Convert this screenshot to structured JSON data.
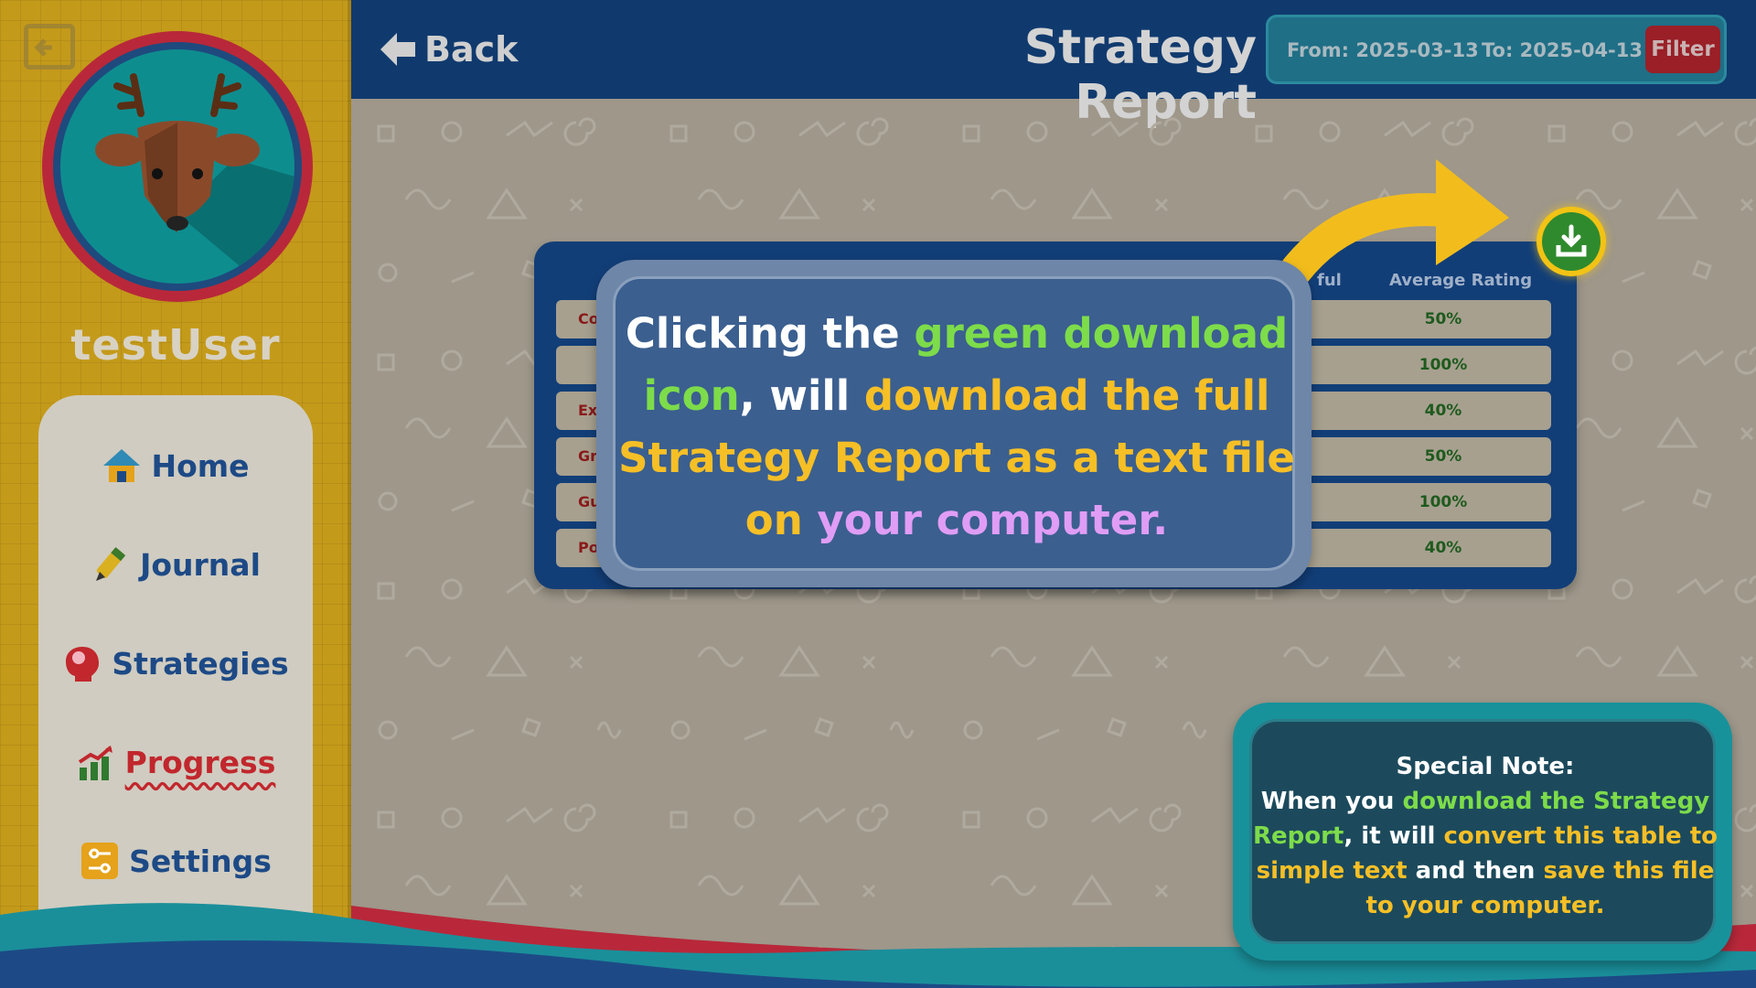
{
  "sidebar": {
    "username": "testUser",
    "nav": [
      {
        "label": "Home",
        "icon": "home-icon",
        "color": "#1d4a86"
      },
      {
        "label": "Journal",
        "icon": "pencil-icon",
        "color": "#1d4a86"
      },
      {
        "label": "Strategies",
        "icon": "brain-head-icon",
        "color": "#1d4a86"
      },
      {
        "label": "Progress",
        "icon": "growth-chart-icon",
        "color": "#c1272d",
        "active": true
      },
      {
        "label": "Settings",
        "icon": "sliders-icon",
        "color": "#1d4a86"
      }
    ]
  },
  "header": {
    "back_label": "Back",
    "title": "Strategy Report",
    "from_label": "From: 2025-03-13",
    "to_label": "To: 2025-04-13",
    "filter_label": "Filter"
  },
  "table": {
    "col_useful": "ful",
    "col_avg": "Average Rating",
    "rows": [
      {
        "name": "Co",
        "avg": "50%"
      },
      {
        "name": "",
        "avg": "100%"
      },
      {
        "name": "Ex",
        "avg": "40%"
      },
      {
        "name": "Gr",
        "avg": "50%"
      },
      {
        "name": "Gu",
        "avg": "100%"
      },
      {
        "name": "Po",
        "avg": "40%"
      }
    ]
  },
  "callout": {
    "p1": "Clicking the ",
    "p2": "green download icon",
    "p3": ", will ",
    "p4": "download the full Strategy Report as a text file on ",
    "p5": "your computer."
  },
  "note": {
    "title": "Special Note:",
    "p1": "When you ",
    "p2": "download the Strategy Report",
    "p3": ", it will ",
    "p4": "convert this table to simple text",
    "p5": " and then ",
    "p6": "save this file to your computer."
  },
  "colors": {
    "header_bg": "#103a6e",
    "sidebar_bg": "#c49a1a",
    "highlight_green": "#7ddc4a",
    "highlight_yellow": "#f6bf26",
    "highlight_purple": "#e09df5",
    "filter_red": "#9a1f27"
  }
}
